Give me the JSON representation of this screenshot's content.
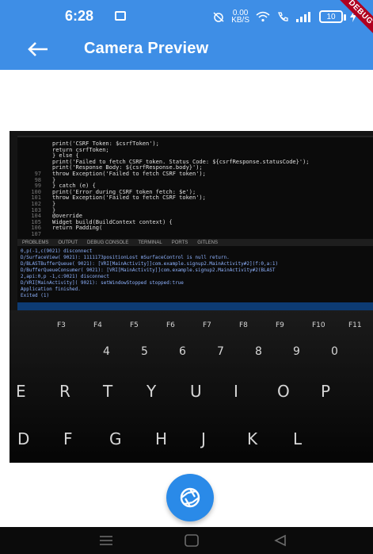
{
  "status_bar": {
    "time": "6:28",
    "speed_value": "0.00",
    "speed_unit": "KB/S",
    "battery": "10"
  },
  "debug_banner": "DEBUG",
  "app_bar": {
    "title": "Camera Preview",
    "back_icon": "arrow-left-icon"
  },
  "preview": {
    "code_lines": [
      {
        "num": "",
        "text": "print('CSRF Token: $csrfToken');"
      },
      {
        "num": "",
        "text": "return csrfToken;"
      },
      {
        "num": "",
        "text": "} else {"
      },
      {
        "num": "",
        "text": "print('Failed to fetch CSRF token. Status Code: ${csrfResponse.statusCode}');"
      },
      {
        "num": "",
        "text": "print('Response Body: ${csrfResponse.body}');"
      },
      {
        "num": "97",
        "text": "throw Exception('Failed to fetch CSRF token');"
      },
      {
        "num": "98",
        "text": "}"
      },
      {
        "num": "99",
        "text": "} catch (e) {"
      },
      {
        "num": "100",
        "text": "print('Error during CSRF token fetch: $e');"
      },
      {
        "num": "101",
        "text": "throw Exception('Failed to fetch CSRF token');"
      },
      {
        "num": "102",
        "text": "}"
      },
      {
        "num": "103",
        "text": "}"
      },
      {
        "num": "104",
        "text": "@override"
      },
      {
        "num": "105",
        "text": "Widget build(BuildContext context) {"
      },
      {
        "num": "106",
        "text": "return Padding("
      },
      {
        "num": "107",
        "text": ""
      }
    ],
    "panel_tabs": [
      "PROBLEMS",
      "OUTPUT",
      "DEBUG CONSOLE",
      "TERMINAL",
      "PORTS",
      "GITLENS"
    ],
    "console_lines": [
      "0,p(-1,c(9021) disconnect",
      "D/SurfaceView( 9021): 1111173positionLost mSurfaceControl is null return.",
      "D/BLASTBufferQueue( 9021): [VRI[MainActivity]]com.example.signup2.MainActivity#2](f:0,a:1)",
      "D/BufferQueueConsumer( 9021): [VRI[MainActivity]]com.example.signup2.MainActivity#2(BLAST",
      "2,api:0,p -1,c:9021) disconnect",
      "D/VRI[MainActivity]( 9021): setWindowStopped stopped:true",
      "Application finished.",
      "Exited (1)"
    ],
    "keyboard_keys": [
      "F3",
      "F4",
      "F5",
      "F6",
      "F7",
      "F8",
      "F9",
      "F10",
      "F11",
      "4",
      "5",
      "6",
      "7",
      "8",
      "9",
      "0",
      "E",
      "R",
      "T",
      "Y",
      "U",
      "I",
      "O",
      "P",
      "D",
      "F",
      "G",
      "H",
      "J",
      "K",
      "L"
    ]
  },
  "fab": {
    "icon": "camera-shutter-icon",
    "color": "#2a8ae8"
  },
  "nav_bar": {
    "menu_icon": "menu-icon",
    "home_icon": "home-icon",
    "back_icon": "triangle-back-icon"
  },
  "colors": {
    "app_bar": "#3e8ee6",
    "debug_banner": "#b00020",
    "nav_bar": "#0b0b0b"
  }
}
